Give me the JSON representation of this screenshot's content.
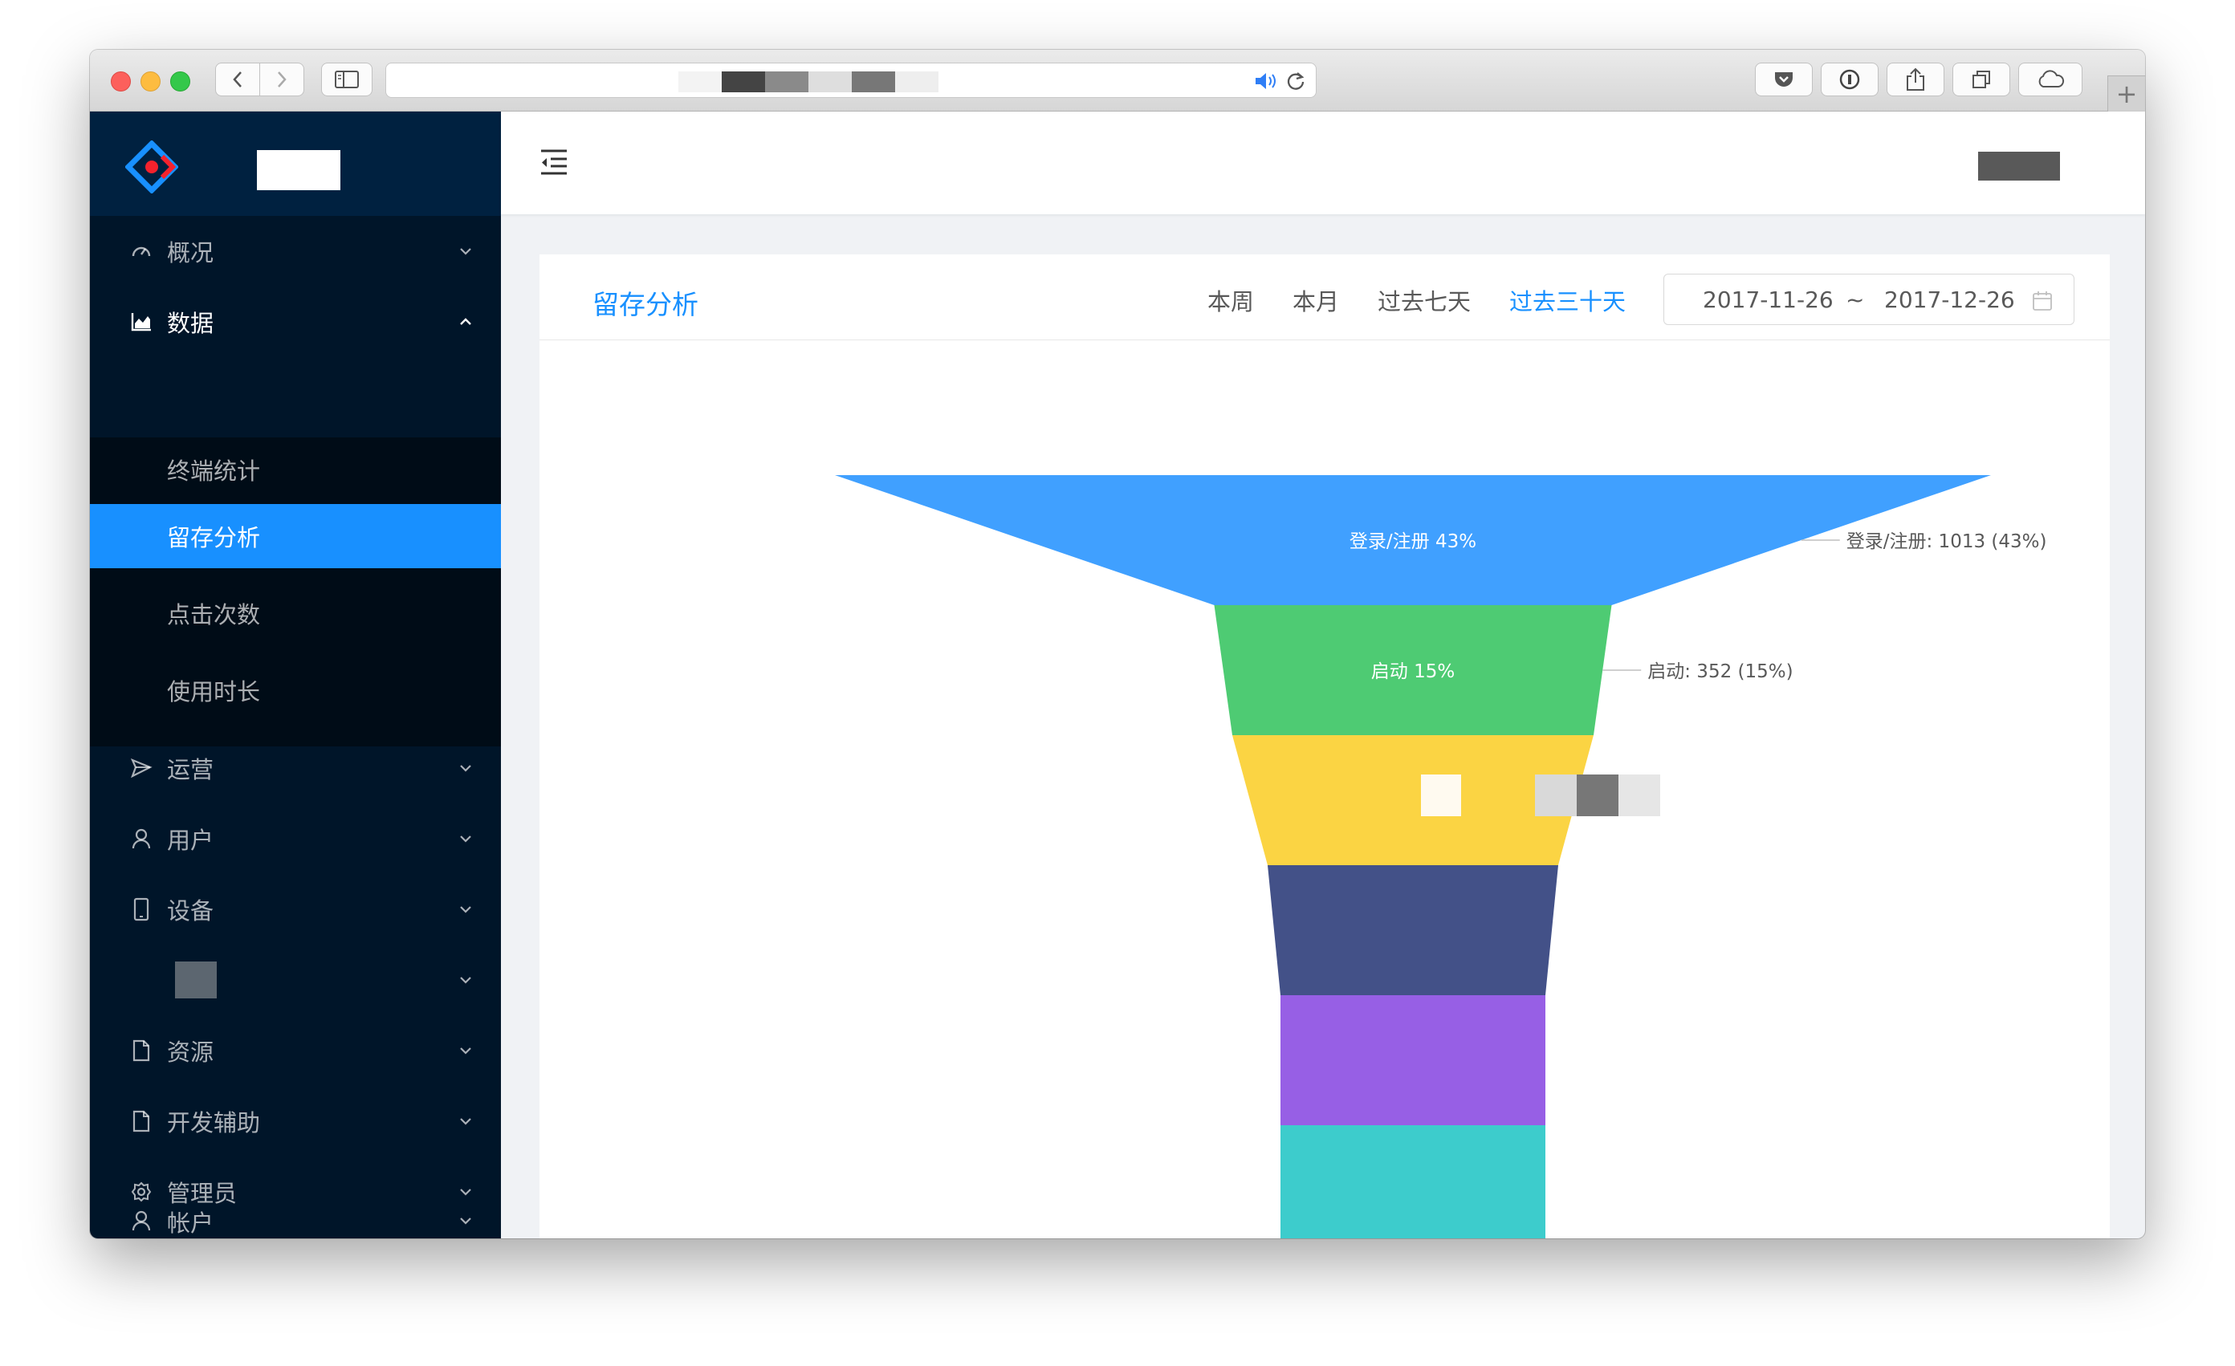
{
  "browser": {
    "nav_back_icon": "chevron-left-icon",
    "nav_forward_icon": "chevron-right-icon",
    "sidebar_toggle_icon": "sidebar-icon",
    "speaker_icon": "speaker-icon",
    "reload_icon": "reload-icon",
    "toolbar_icons": [
      "pocket-icon",
      "password-icon",
      "share-icon",
      "tabs-icon",
      "cloud-icon"
    ],
    "new_tab_label": "+"
  },
  "sidebar": {
    "items": [
      {
        "label": "概况",
        "icon": "dashboard-icon",
        "open": false
      },
      {
        "label": "数据",
        "icon": "area-chart-icon",
        "open": true
      },
      {
        "label": "运营",
        "icon": "send-icon",
        "open": false
      },
      {
        "label": "用户",
        "icon": "user-icon",
        "open": false
      },
      {
        "label": "设备",
        "icon": "mobile-icon",
        "open": false
      },
      {
        "label": "",
        "icon": "redacted-icon",
        "open": false
      },
      {
        "label": "资源",
        "icon": "file-icon",
        "open": false
      },
      {
        "label": "开发辅助",
        "icon": "file-icon",
        "open": false
      },
      {
        "label": "管理员",
        "icon": "setting-icon",
        "open": false
      },
      {
        "label": "帐户",
        "icon": "user-icon",
        "open": false
      }
    ],
    "subitems": [
      {
        "label": "终端统计",
        "active": false
      },
      {
        "label": "留存分析",
        "active": true
      },
      {
        "label": "点击次数",
        "active": false
      },
      {
        "label": "使用时长",
        "active": false
      }
    ]
  },
  "header": {
    "menu_toggle_icon": "menu-fold-icon"
  },
  "card": {
    "title": "留存分析",
    "ranges": [
      {
        "label": "本周",
        "active": false
      },
      {
        "label": "本月",
        "active": false
      },
      {
        "label": "过去七天",
        "active": false
      },
      {
        "label": "过去三十天",
        "active": true
      }
    ],
    "date_start": "2017-11-26",
    "date_sep": "~",
    "date_end": "2017-12-26",
    "calendar_icon": "calendar-icon"
  },
  "chart_data": {
    "type": "funnel",
    "title": "",
    "stages": [
      {
        "name": "登录/注册",
        "value": 1013,
        "percent": 43,
        "inner_label": "登录/注册 43%",
        "outer_label": "登录/注册: 1013 (43%)",
        "color": "#40a0ff"
      },
      {
        "name": "启动",
        "value": 352,
        "percent": 15,
        "inner_label": "启动 15%",
        "outer_label": "启动: 352 (15%)",
        "color": "#4ecb73"
      },
      {
        "name": "",
        "value": null,
        "percent": null,
        "inner_label": "",
        "outer_label": "",
        "color": "#fbd443"
      },
      {
        "name": "",
        "value": null,
        "percent": null,
        "inner_label": "",
        "outer_label": "",
        "color": "#435188"
      },
      {
        "name": "",
        "value": null,
        "percent": null,
        "inner_label": "",
        "outer_label": "",
        "color": "#975fe5"
      },
      {
        "name": "",
        "value": null,
        "percent": null,
        "inner_label": "",
        "outer_label": "",
        "color": "#3dcccc"
      }
    ]
  }
}
